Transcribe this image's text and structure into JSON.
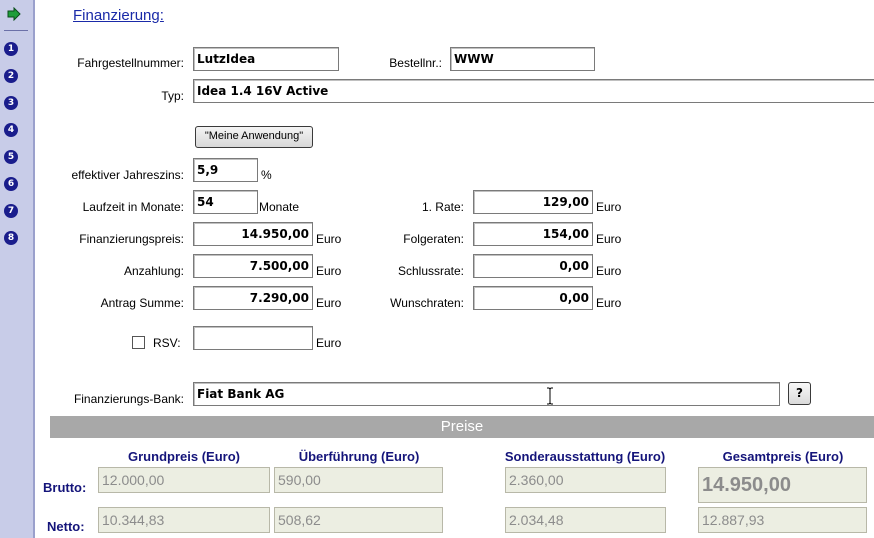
{
  "nav": {
    "steps": [
      "1",
      "2",
      "3",
      "4",
      "5",
      "6",
      "7",
      "8"
    ]
  },
  "title": "Finanzierung:",
  "form": {
    "fahrgestell_label": "Fahrgestellnummer:",
    "fahrgestell_value": "LutzIdea",
    "bestellnr_label": "Bestellnr.:",
    "bestellnr_value": "WWW",
    "typ_label": "Typ:",
    "typ_value": "Idea 1.4 16V Active",
    "app_button": "\"Meine Anwendung\"",
    "zins_label": "effektiver Jahreszins:",
    "zins_value": "5,9",
    "zins_unit": "%",
    "laufzeit_label": "Laufzeit in Monate:",
    "laufzeit_value": "54",
    "laufzeit_unit": "Monate",
    "finanzpreis_label": "Finanzierungspreis:",
    "finanzpreis_value": "14.950,00",
    "anzahlung_label": "Anzahlung:",
    "anzahlung_value": "7.500,00",
    "antrag_label": "Antrag Summe:",
    "antrag_value": "7.290,00",
    "rsv_label": "RSV:",
    "rsv_value": "",
    "rate1_label": "1. Rate:",
    "rate1_value": "129,00",
    "folgeraten_label": "Folgeraten:",
    "folgeraten_value": "154,00",
    "schlussrate_label": "Schlussrate:",
    "schlussrate_value": "0,00",
    "wunschraten_label": "Wunschraten:",
    "wunschraten_value": "0,00",
    "euro": "Euro",
    "bank_label": "Finanzierungs-Bank:",
    "bank_value": "Fiat Bank AG",
    "help_button": "?"
  },
  "preise": {
    "header": "Preise",
    "columns": [
      "Grundpreis (Euro)",
      "Überführung (Euro)",
      "Sonderausstattung (Euro)",
      "Gesamtpreis (Euro)"
    ],
    "brutto_label": "Brutto:",
    "netto_label": "Netto:",
    "brutto": [
      "12.000,00",
      "590,00",
      "2.360,00",
      "14.950,00"
    ],
    "netto": [
      "10.344,83",
      "508,62",
      "2.034,48",
      "12.887,93"
    ]
  },
  "colors": {
    "nav_bg": "#c8cce8",
    "step_badge": "#1a1d8c",
    "link": "#1a2aa8",
    "header_bar": "#a8a8a8"
  },
  "icons": {
    "nav_arrow": "green-arrow-right-icon",
    "step": "numbered-circle-icon",
    "text_cursor": "i-beam-cursor-icon"
  }
}
